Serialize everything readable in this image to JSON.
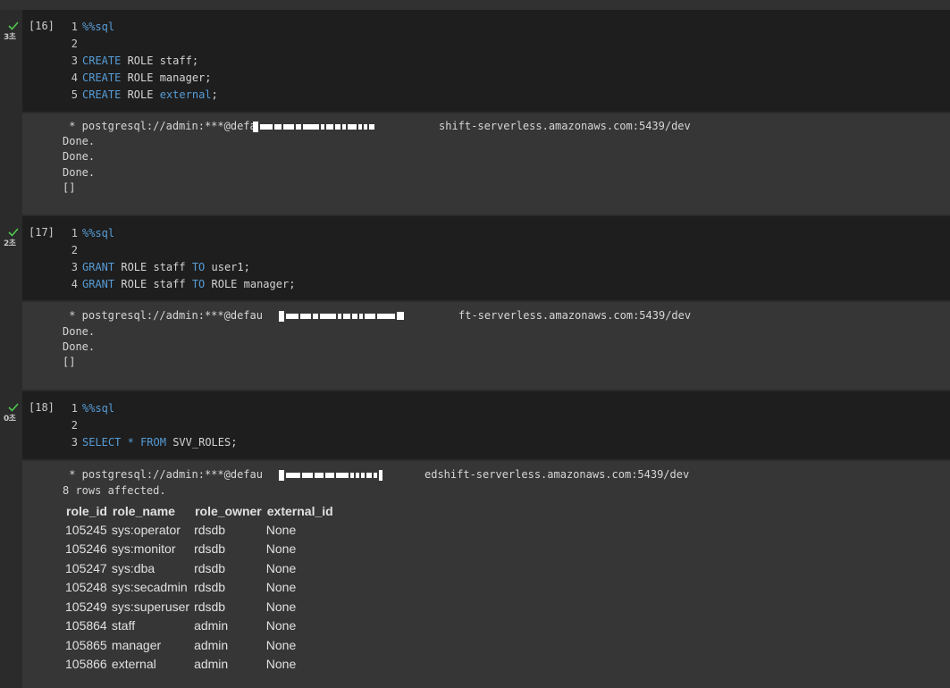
{
  "cells": [
    {
      "exec_count": "[16]",
      "timing": "3초",
      "lines": [
        {
          "n": "1",
          "parts": [
            {
              "k": "kw",
              "t": "%%sql"
            }
          ]
        },
        {
          "n": "2",
          "parts": []
        },
        {
          "n": "3",
          "parts": [
            {
              "k": "kw",
              "t": "CREATE"
            },
            {
              "k": "tx",
              "t": " ROLE staff;"
            }
          ]
        },
        {
          "n": "4",
          "parts": [
            {
              "k": "kw",
              "t": "CREATE"
            },
            {
              "k": "tx",
              "t": " ROLE manager;"
            }
          ]
        },
        {
          "n": "5",
          "parts": [
            {
              "k": "kw",
              "t": "CREATE"
            },
            {
              "k": "tx",
              "t": " ROLE "
            },
            {
              "k": "kw",
              "t": "external"
            },
            {
              "k": "tx",
              "t": ";"
            }
          ]
        }
      ],
      "conn_prefix": " * postgresql://admin:***@defa",
      "conn_suffix": "shift-serverless.amazonaws.com:5439/dev",
      "output": [
        "Done.",
        "Done.",
        "Done.",
        "[]"
      ]
    },
    {
      "exec_count": "[17]",
      "timing": "2초",
      "lines": [
        {
          "n": "1",
          "parts": [
            {
              "k": "kw",
              "t": "%%sql"
            }
          ]
        },
        {
          "n": "2",
          "parts": []
        },
        {
          "n": "3",
          "parts": [
            {
              "k": "kw",
              "t": "GRANT"
            },
            {
              "k": "tx",
              "t": " ROLE staff "
            },
            {
              "k": "kw",
              "t": "TO"
            },
            {
              "k": "tx",
              "t": " user1;"
            }
          ]
        },
        {
          "n": "4",
          "parts": [
            {
              "k": "kw",
              "t": "GRANT"
            },
            {
              "k": "tx",
              "t": " ROLE staff "
            },
            {
              "k": "kw",
              "t": "TO"
            },
            {
              "k": "tx",
              "t": " ROLE manager;"
            }
          ]
        }
      ],
      "conn_prefix": " * postgresql://admin:***@defau",
      "conn_suffix": "ft-serverless.amazonaws.com:5439/dev",
      "output": [
        "Done.",
        "Done.",
        "[]"
      ]
    },
    {
      "exec_count": "[18]",
      "timing": "0초",
      "lines": [
        {
          "n": "1",
          "parts": [
            {
              "k": "kw",
              "t": "%%sql"
            }
          ]
        },
        {
          "n": "2",
          "parts": []
        },
        {
          "n": "3",
          "parts": [
            {
              "k": "kw",
              "t": "SELECT"
            },
            {
              "k": "tx",
              "t": " "
            },
            {
              "k": "kw",
              "t": "*"
            },
            {
              "k": "tx",
              "t": " "
            },
            {
              "k": "kw",
              "t": "FROM"
            },
            {
              "k": "tx",
              "t": " SVV_ROLES;"
            }
          ]
        }
      ],
      "conn_prefix": " * postgresql://admin:***@defau",
      "conn_suffix": "edshift-serverless.amazonaws.com:5439/dev",
      "output": [
        "8 rows affected."
      ]
    }
  ],
  "table": {
    "headers": [
      "role_id",
      "role_name",
      "role_owner",
      "external_id"
    ],
    "rows": [
      [
        "105245",
        "sys:operator",
        "rdsdb",
        "None"
      ],
      [
        "105246",
        "sys:monitor",
        "rdsdb",
        "None"
      ],
      [
        "105247",
        "sys:dba",
        "rdsdb",
        "None"
      ],
      [
        "105248",
        "sys:secadmin",
        "rdsdb",
        "None"
      ],
      [
        "105249",
        "sys:superuser",
        "rdsdb",
        "None"
      ],
      [
        "105864",
        "staff",
        "admin",
        "None"
      ],
      [
        "105865",
        "manager",
        "admin",
        "None"
      ],
      [
        "105866",
        "external",
        "admin",
        "None"
      ]
    ]
  },
  "colors": {
    "keyword": "#569cd6",
    "input_bg": "#1e1e1e",
    "output_bg": "#363636",
    "check": "#4ec94e"
  }
}
